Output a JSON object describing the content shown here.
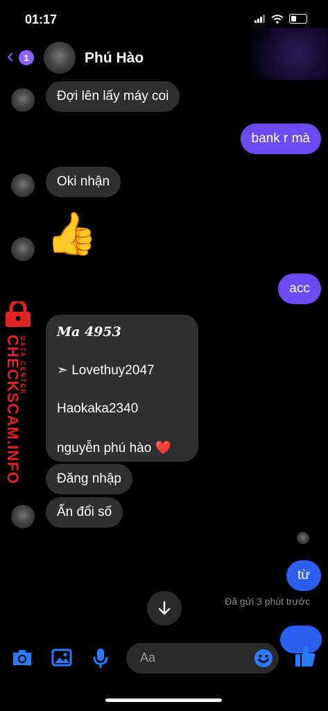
{
  "status": {
    "time": "01:17"
  },
  "header": {
    "back_count": "1",
    "contact_name": "Phú Hào"
  },
  "messages": {
    "m1": "Đợi lên lấy máy coi",
    "m2": "bank r mà",
    "m3": "Oki nhận",
    "m4": "👍",
    "m5": "acc",
    "card_title": "Ma 4953",
    "card_line1": "➣ Lovethuy2047",
    "card_line2": "Haokaka2340",
    "card_line3": "nguyễn phú hào ❤️",
    "m6": "Đăng nhập",
    "m7": "Ấn đổi số",
    "m8": "từ",
    "sent_status": "Đã gửi 3 phút trước"
  },
  "watermark": {
    "main": "CHECKSCAM.INFO",
    "sub": "DATA CENTER"
  },
  "composer": {
    "placeholder": "Aa"
  },
  "colors": {
    "accent": "#8f5cff",
    "outgoing": "#6a4cf2",
    "outgoing_latest": "#2a5ff0",
    "incoming": "#303030",
    "icon_blue": "#2b7bff"
  }
}
